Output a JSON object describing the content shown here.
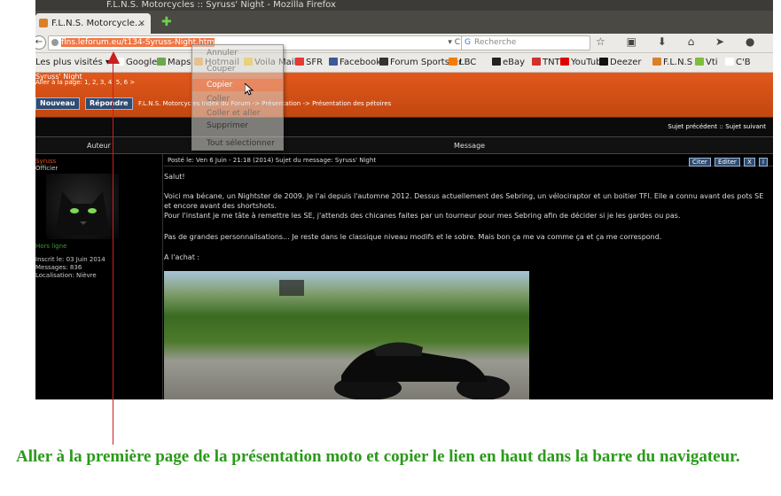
{
  "window": {
    "title": "F.L.N.S. Motorcycles :: Syruss' Night - Mozilla Firefox"
  },
  "tab": {
    "label": "F.L.N.S. Motorcycle...",
    "close": "×",
    "new_tab": "✚"
  },
  "navbar": {
    "back": "←",
    "url_selected": "flns.leforum.eu/t134-Syruss-Night.htm",
    "reload": "▾ C",
    "search_placeholder": "Recherche",
    "search_engine_icon": "G",
    "toolbar_icons": "☆ ▣ ⬇ ⌂ ➤ ● ▾ ☻ ≡"
  },
  "bookmarks": [
    {
      "label": "Les plus visités ▾",
      "icon_color": ""
    },
    {
      "label": "Google",
      "icon_color": "#ffffff"
    },
    {
      "label": "Maps",
      "icon_color": "#6aa84f"
    },
    {
      "label": "Hotmail",
      "icon_color": "#f4a340"
    },
    {
      "label": "Voila Mail",
      "icon_color": "#f5c518"
    },
    {
      "label": "SFR",
      "icon_color": "#e53935"
    },
    {
      "label": "Facebook",
      "icon_color": "#3b5998"
    },
    {
      "label": "Forum Sportster",
      "icon_color": "#333333"
    },
    {
      "label": "LBC",
      "icon_color": "#f57c00"
    },
    {
      "label": "eBay",
      "icon_color": "#222222"
    },
    {
      "label": "TNT",
      "icon_color": "#d32f2f"
    },
    {
      "label": "YouTube",
      "icon_color": "#e00000"
    },
    {
      "label": "Deezer",
      "icon_color": "#111111"
    },
    {
      "label": "F.L.N.S",
      "icon_color": "#d8802a"
    },
    {
      "label": "Vti",
      "icon_color": "#7bbf3a"
    },
    {
      "label": "C'B",
      "icon_color": "#ffffff"
    }
  ],
  "context_menu": {
    "items": [
      {
        "label": "Annuler",
        "state": "disabled"
      },
      {
        "label": "Couper",
        "state": "disabled"
      },
      {
        "label": "Copier",
        "state": "highlighted"
      },
      {
        "label": "Coller",
        "state": "disabled"
      },
      {
        "label": "Coller et aller",
        "state": "disabled"
      },
      {
        "label": "Supprimer",
        "state": "normal"
      },
      {
        "label": "Tout sélectionner",
        "state": "normal"
      }
    ]
  },
  "forum": {
    "topic_title": "Syruss' Night",
    "pages_label": "Aller à la page: 1, 2, 3, 4, 5, 6  >",
    "new_button": "Nouveau",
    "reply_button": "Répondre",
    "breadcrumb": "F.L.N.S. Motorcycles Index du Forum -> Présentation -> Présentation des pétoires",
    "topic_nav": "Sujet précédent :: Sujet suivant",
    "col_author": "Auteur",
    "col_message": "Message",
    "user": {
      "name": "Syruss",
      "rank": "Officier",
      "status": "Hors ligne",
      "info": [
        "Inscrit le: 03 Juin 2014",
        "Messages: 836",
        "Localisation: Nièvre"
      ]
    },
    "post": {
      "header": "Posté le: Ven 6 Juin - 21:18 (2014)    Sujet du message: Syruss' Night",
      "buttons": [
        "Citer",
        "Editer",
        "X",
        "i"
      ],
      "paragraphs": [
        "Salut!",
        "Voici ma bécane, un Nightster de 2009. Je l'ai depuis l'automne 2012. Dessus actuellement des Sebring, un vélociraptor et un boitier TFI. Elle a connu avant des pots SE et encore avant des shortshots.",
        "Pour l'instant je me tâte à remettre les SE, j'attends des chicanes faites par un tourneur pour mes Sebring afin de décider si je les gardes ou pas.",
        "Pas de grandes personnalisations... Je reste dans le classique niveau modifs et le sobre. Mais bon ça me va comme ça et ça me correspond.",
        "A l'achat :"
      ]
    }
  },
  "annotation": {
    "caption": "Aller à la première page de la présentation moto et copier le lien en haut dans la barre du navigateur.",
    "arrow_color": "#cc1e1e",
    "caption_color": "#2a9a1a"
  }
}
